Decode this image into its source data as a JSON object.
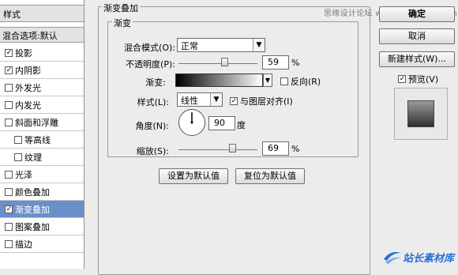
{
  "watermark": "思缘设计论坛 www.missyuan.com",
  "left_panel": {
    "header": "样式",
    "blend_options": "混合选项:默认",
    "items": [
      {
        "label": "投影",
        "checked": true,
        "selected": false,
        "sub": false
      },
      {
        "label": "内阴影",
        "checked": true,
        "selected": false,
        "sub": false
      },
      {
        "label": "外发光",
        "checked": false,
        "selected": false,
        "sub": false
      },
      {
        "label": "内发光",
        "checked": false,
        "selected": false,
        "sub": false
      },
      {
        "label": "斜面和浮雕",
        "checked": false,
        "selected": false,
        "sub": false
      },
      {
        "label": "等高线",
        "checked": false,
        "selected": false,
        "sub": true
      },
      {
        "label": "纹理",
        "checked": false,
        "selected": false,
        "sub": true
      },
      {
        "label": "光泽",
        "checked": false,
        "selected": false,
        "sub": false
      },
      {
        "label": "颜色叠加",
        "checked": false,
        "selected": false,
        "sub": false
      },
      {
        "label": "渐变叠加",
        "checked": true,
        "selected": true,
        "sub": false
      },
      {
        "label": "图案叠加",
        "checked": false,
        "selected": false,
        "sub": false
      },
      {
        "label": "描边",
        "checked": false,
        "selected": false,
        "sub": false
      }
    ]
  },
  "main": {
    "group_title": "渐变叠加",
    "sub_title": "渐变",
    "blend_mode": {
      "label": "混合模式(O):",
      "value": "正常"
    },
    "opacity": {
      "label": "不透明度(P):",
      "value": "59",
      "unit": "%",
      "level": 0.59
    },
    "gradient": {
      "label": "渐变:",
      "reverse_label": "反向(R)",
      "reverse_checked": false
    },
    "style": {
      "label": "样式(L):",
      "value": "线性",
      "align_label": "与图层对齐(I)",
      "align_checked": true
    },
    "angle": {
      "label": "角度(N):",
      "value": "90",
      "unit": "度"
    },
    "scale": {
      "label": "缩放(S):",
      "value": "69",
      "unit": "%",
      "level": 0.69
    },
    "set_default": "设置为默认值",
    "reset_default": "复位为默认值"
  },
  "right_panel": {
    "ok": "确定",
    "cancel": "取消",
    "new_style": "新建样式(W)...",
    "preview_label": "预览(V)",
    "preview_checked": true
  },
  "logo": "站长素材库"
}
